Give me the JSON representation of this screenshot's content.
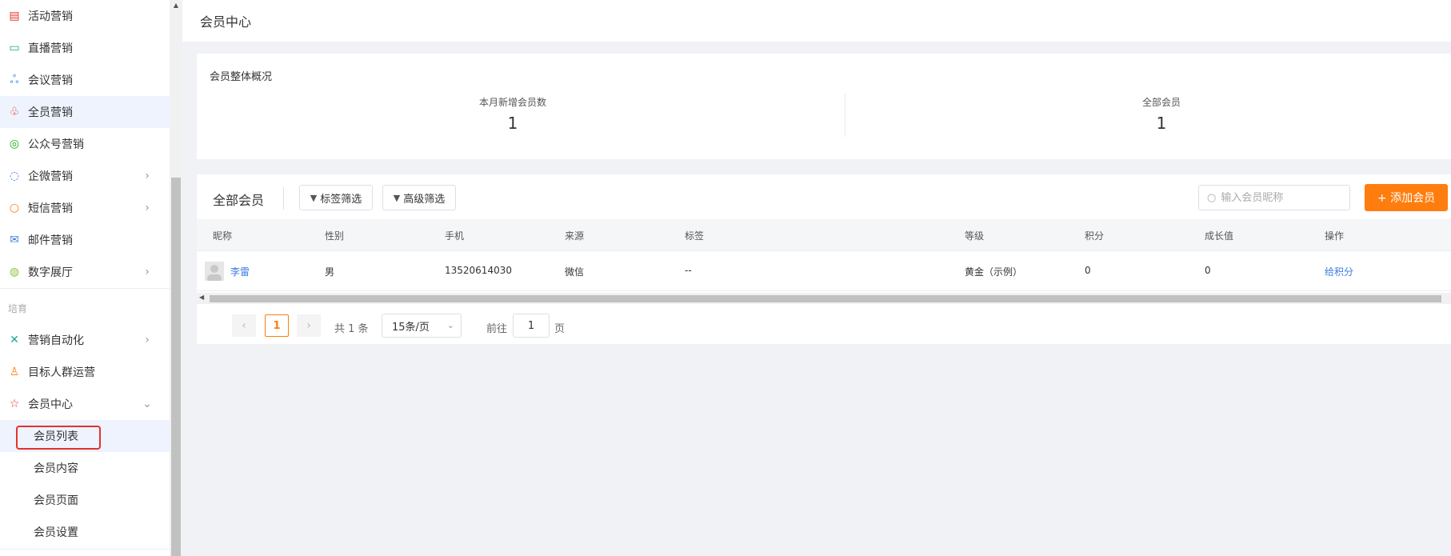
{
  "sidebar": {
    "items": [
      {
        "label": "活动营销",
        "icon": "calendar-icon",
        "color": "#e5322d"
      },
      {
        "label": "直播营销",
        "icon": "video-icon",
        "color": "#1aa89a"
      },
      {
        "label": "会议营销",
        "icon": "people-icon",
        "color": "#3a7be0"
      },
      {
        "label": "全员营销",
        "icon": "team-icon",
        "color": "#e5322d"
      },
      {
        "label": "公众号营销",
        "icon": "wechat-icon",
        "color": "#1aad19"
      },
      {
        "label": "企微营销",
        "icon": "chat-icon",
        "color": "#3a7be0"
      },
      {
        "label": "短信营销",
        "icon": "message-icon",
        "color": "#ff7d0f"
      },
      {
        "label": "邮件营销",
        "icon": "mail-icon",
        "color": "#3a7be0"
      },
      {
        "label": "数字展厅",
        "icon": "globe-icon",
        "color": "#8dc63f"
      }
    ],
    "group_label": "培育",
    "group_items": [
      {
        "label": "营销自动化",
        "icon": "flow-icon",
        "color": "#1aa89a"
      },
      {
        "label": "目标人群运营",
        "icon": "target-user-icon",
        "color": "#ff7d0f"
      },
      {
        "label": "会员中心",
        "icon": "star-user-icon",
        "color": "#e5322d"
      }
    ],
    "sub_items": [
      "会员列表",
      "会员内容",
      "会员页面",
      "会员设置"
    ]
  },
  "header": {
    "title": "会员中心"
  },
  "overview": {
    "title": "会员整体概况",
    "stats": [
      {
        "label": "本月新增会员数",
        "value": "1"
      },
      {
        "label": "全部会员",
        "value": "1"
      }
    ]
  },
  "toolbar": {
    "title": "全部会员",
    "tag_filter": "标签筛选",
    "advanced_filter": "高级筛选",
    "search_placeholder": "输入会员昵称",
    "add_label": "+ 添加会员"
  },
  "table": {
    "columns": [
      "昵称",
      "性别",
      "手机",
      "来源",
      "标签",
      "等级",
      "积分",
      "成长值",
      "操作"
    ],
    "rows": [
      {
        "name": "李雷",
        "gender": "男",
        "phone": "13520614030",
        "source": "微信",
        "tags": "--",
        "level": "黄金（示例）",
        "points": "0",
        "growth": "0",
        "action": "给积分"
      }
    ]
  },
  "pagination": {
    "current": "1",
    "total_text": "共 1 条",
    "page_size": "15条/页",
    "goto_prefix": "前往",
    "goto_value": "1",
    "goto_suffix": "页"
  },
  "colors": {
    "accent": "#ff7d0f",
    "link": "#3a7be0",
    "highlight": "#e5322d"
  }
}
